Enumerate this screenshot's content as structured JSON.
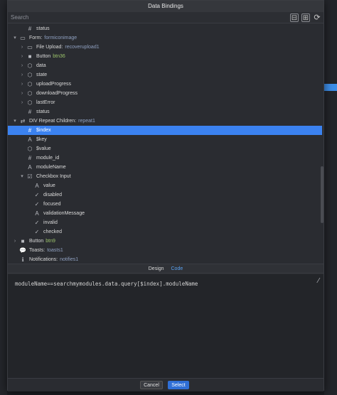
{
  "dialog": {
    "title": "Data Bindings",
    "search_placeholder": "Search",
    "tools": {
      "collapse": "⊟",
      "expand": "⊞",
      "refresh": "⟳"
    }
  },
  "tree": [
    {
      "indent": 1,
      "caret": "",
      "icon": "#",
      "label": "status",
      "sub": ""
    },
    {
      "indent": 0,
      "caret": "▾",
      "icon": "▭",
      "label": "Form:",
      "sub": "formiconimage"
    },
    {
      "indent": 1,
      "caret": "›",
      "icon": "▭",
      "label": "File Upload:",
      "sub": "recoverupload1"
    },
    {
      "indent": 1,
      "caret": "›",
      "icon": "■",
      "label": "Button",
      "sub": "btn36"
    },
    {
      "indent": 1,
      "caret": "›",
      "icon": "⬡",
      "label": "data",
      "sub": ""
    },
    {
      "indent": 1,
      "caret": "›",
      "icon": "⬡",
      "label": "state",
      "sub": ""
    },
    {
      "indent": 1,
      "caret": "›",
      "icon": "⬡",
      "label": "uploadProgress",
      "sub": ""
    },
    {
      "indent": 1,
      "caret": "›",
      "icon": "⬡",
      "label": "downloadProgress",
      "sub": ""
    },
    {
      "indent": 1,
      "caret": "›",
      "icon": "⬡",
      "label": "lastError",
      "sub": ""
    },
    {
      "indent": 1,
      "caret": "",
      "icon": "#",
      "label": "status",
      "sub": ""
    },
    {
      "indent": 0,
      "caret": "▾",
      "icon": "⇄",
      "label": "DIV Repeat Children:",
      "sub": "repeat1"
    },
    {
      "indent": 1,
      "caret": "",
      "icon": "#",
      "label": "$index",
      "sub": "",
      "selected": true
    },
    {
      "indent": 1,
      "caret": "",
      "icon": "A",
      "label": "$key",
      "sub": ""
    },
    {
      "indent": 1,
      "caret": "",
      "icon": "⬡",
      "label": "$value",
      "sub": ""
    },
    {
      "indent": 1,
      "caret": "",
      "icon": "#",
      "label": "module_id",
      "sub": ""
    },
    {
      "indent": 1,
      "caret": "",
      "icon": "A",
      "label": "moduleName",
      "sub": ""
    },
    {
      "indent": 1,
      "caret": "▾",
      "icon": "☑",
      "label": "Checkbox Input",
      "sub": ""
    },
    {
      "indent": 2,
      "caret": "",
      "icon": "A",
      "label": "value",
      "sub": ""
    },
    {
      "indent": 2,
      "caret": "",
      "icon": "✓",
      "label": "disabled",
      "sub": ""
    },
    {
      "indent": 2,
      "caret": "",
      "icon": "✓",
      "label": "focused",
      "sub": ""
    },
    {
      "indent": 2,
      "caret": "",
      "icon": "A",
      "label": "validationMessage",
      "sub": ""
    },
    {
      "indent": 2,
      "caret": "",
      "icon": "✓",
      "label": "invalid",
      "sub": ""
    },
    {
      "indent": 2,
      "caret": "",
      "icon": "✓",
      "label": "checked",
      "sub": ""
    },
    {
      "indent": 0,
      "caret": "›",
      "icon": "■",
      "label": "Button",
      "sub": "btn9"
    },
    {
      "indent": 0,
      "caret": "",
      "icon": "💬",
      "label": "Toasts:",
      "sub": "toasts1"
    },
    {
      "indent": 0,
      "caret": "",
      "icon": "ℹ",
      "label": "Notifications:",
      "sub": "notifies1"
    }
  ],
  "tabs": {
    "design": "Design",
    "code": "Code"
  },
  "editor": {
    "code": "moduleName==searchmymodules.data.query[$index].moduleName"
  },
  "footer": {
    "cancel": "Cancel",
    "select": "Select"
  },
  "colors": {
    "accent": "#3b82f0",
    "button_primary": "#2f6fd6"
  }
}
